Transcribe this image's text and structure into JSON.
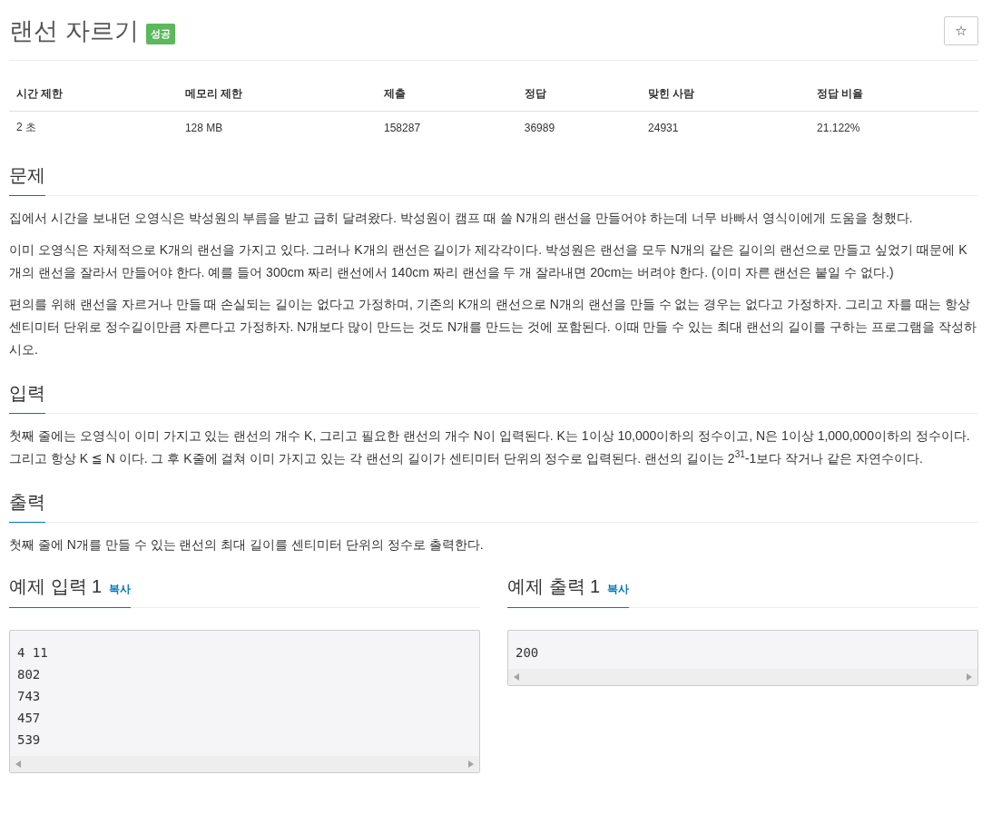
{
  "title": "랜선 자르기",
  "result_badge": "성공",
  "favorite_button": "☆",
  "stats": {
    "columns": [
      "시간 제한",
      "메모리 제한",
      "제출",
      "정답",
      "맞힌 사람",
      "정답 비율"
    ],
    "rows": [
      [
        "2 초",
        "128 MB",
        "158287",
        "36989",
        "24931",
        "21.122%"
      ]
    ]
  },
  "sections": [
    {
      "heading": "문제",
      "paragraphs": [
        "집에서 시간을 보내던 오영식은 박성원의 부름을 받고 급히 달려왔다. 박성원이 캠프 때 쓸 N개의 랜선을 만들어야 하는데 너무 바빠서 영식이에게 도움을 청했다.",
        "이미 오영식은 자체적으로 K개의 랜선을 가지고 있다. 그러나 K개의 랜선은 길이가 제각각이다. 박성원은 랜선을 모두 N개의 같은 길이의 랜선으로 만들고 싶었기 때문에 K개의 랜선을 잘라서 만들어야 한다. 예를 들어 300cm 짜리 랜선에서 140cm 짜리 랜선을 두 개 잘라내면 20cm는 버려야 한다. (이미 자른 랜선은 붙일 수 없다.)",
        "편의를 위해 랜선을 자르거나 만들 때 손실되는 길이는 없다고 가정하며, 기존의 K개의 랜선으로 N개의 랜선을 만들 수 없는 경우는 없다고 가정하자. 그리고 자를 때는 항상 센티미터 단위로 정수길이만큼 자른다고 가정하자. N개보다 많이 만드는 것도 N개를 만드는 것에 포함된다. 이때 만들 수 있는 최대 랜선의 길이를 구하는 프로그램을 작성하시오."
      ]
    },
    {
      "heading": "입력",
      "paragraphs": [
        "첫째 줄에는 오영식이 이미 가지고 있는 랜선의 개수 K, 그리고 필요한 랜선의 개수 N이 입력된다. K는 1이상 10,000이하의 정수이고, N은 1이상 1,000,000이하의 정수이다. 그리고 항상 K ≦ N 이다. 그 후 K줄에 걸쳐 이미 가지고 있는 각 랜선의 길이가 센티미터 단위의 정수로 입력된다. 랜선의 길이는 2$^{31}$-1보다 작거나 같은 자연수이다."
      ]
    },
    {
      "heading": "출력",
      "paragraphs": [
        "첫째 줄에 N개를 만들 수 있는 랜선의 최대 길이를 센티미터 단위의 정수로 출력한다."
      ]
    }
  ],
  "samples": [
    {
      "heading": "예제 입력 1",
      "copy_link": "복사",
      "lines": [
        "4 11",
        "802",
        "743",
        "457",
        "539"
      ]
    },
    {
      "heading": "예제 출력 1",
      "copy_link": "복사",
      "lines": [
        "200"
      ]
    }
  ]
}
